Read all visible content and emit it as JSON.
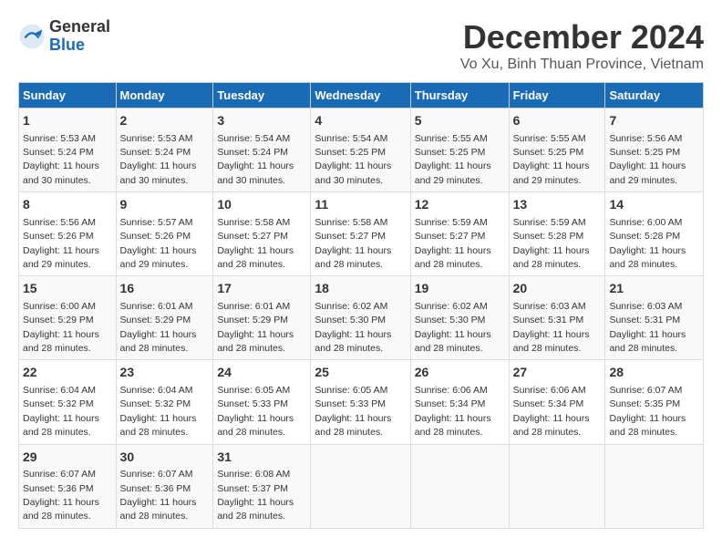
{
  "logo": {
    "general": "General",
    "blue": "Blue"
  },
  "title": "December 2024",
  "subtitle": "Vo Xu, Binh Thuan Province, Vietnam",
  "weekdays": [
    "Sunday",
    "Monday",
    "Tuesday",
    "Wednesday",
    "Thursday",
    "Friday",
    "Saturday"
  ],
  "weeks": [
    [
      {
        "day": "1",
        "sunrise": "5:53 AM",
        "sunset": "5:24 PM",
        "daylight": "11 hours and 30 minutes."
      },
      {
        "day": "2",
        "sunrise": "5:53 AM",
        "sunset": "5:24 PM",
        "daylight": "11 hours and 30 minutes."
      },
      {
        "day": "3",
        "sunrise": "5:54 AM",
        "sunset": "5:24 PM",
        "daylight": "11 hours and 30 minutes."
      },
      {
        "day": "4",
        "sunrise": "5:54 AM",
        "sunset": "5:25 PM",
        "daylight": "11 hours and 30 minutes."
      },
      {
        "day": "5",
        "sunrise": "5:55 AM",
        "sunset": "5:25 PM",
        "daylight": "11 hours and 29 minutes."
      },
      {
        "day": "6",
        "sunrise": "5:55 AM",
        "sunset": "5:25 PM",
        "daylight": "11 hours and 29 minutes."
      },
      {
        "day": "7",
        "sunrise": "5:56 AM",
        "sunset": "5:25 PM",
        "daylight": "11 hours and 29 minutes."
      }
    ],
    [
      {
        "day": "8",
        "sunrise": "5:56 AM",
        "sunset": "5:26 PM",
        "daylight": "11 hours and 29 minutes."
      },
      {
        "day": "9",
        "sunrise": "5:57 AM",
        "sunset": "5:26 PM",
        "daylight": "11 hours and 29 minutes."
      },
      {
        "day": "10",
        "sunrise": "5:58 AM",
        "sunset": "5:27 PM",
        "daylight": "11 hours and 28 minutes."
      },
      {
        "day": "11",
        "sunrise": "5:58 AM",
        "sunset": "5:27 PM",
        "daylight": "11 hours and 28 minutes."
      },
      {
        "day": "12",
        "sunrise": "5:59 AM",
        "sunset": "5:27 PM",
        "daylight": "11 hours and 28 minutes."
      },
      {
        "day": "13",
        "sunrise": "5:59 AM",
        "sunset": "5:28 PM",
        "daylight": "11 hours and 28 minutes."
      },
      {
        "day": "14",
        "sunrise": "6:00 AM",
        "sunset": "5:28 PM",
        "daylight": "11 hours and 28 minutes."
      }
    ],
    [
      {
        "day": "15",
        "sunrise": "6:00 AM",
        "sunset": "5:29 PM",
        "daylight": "11 hours and 28 minutes."
      },
      {
        "day": "16",
        "sunrise": "6:01 AM",
        "sunset": "5:29 PM",
        "daylight": "11 hours and 28 minutes."
      },
      {
        "day": "17",
        "sunrise": "6:01 AM",
        "sunset": "5:29 PM",
        "daylight": "11 hours and 28 minutes."
      },
      {
        "day": "18",
        "sunrise": "6:02 AM",
        "sunset": "5:30 PM",
        "daylight": "11 hours and 28 minutes."
      },
      {
        "day": "19",
        "sunrise": "6:02 AM",
        "sunset": "5:30 PM",
        "daylight": "11 hours and 28 minutes."
      },
      {
        "day": "20",
        "sunrise": "6:03 AM",
        "sunset": "5:31 PM",
        "daylight": "11 hours and 28 minutes."
      },
      {
        "day": "21",
        "sunrise": "6:03 AM",
        "sunset": "5:31 PM",
        "daylight": "11 hours and 28 minutes."
      }
    ],
    [
      {
        "day": "22",
        "sunrise": "6:04 AM",
        "sunset": "5:32 PM",
        "daylight": "11 hours and 28 minutes."
      },
      {
        "day": "23",
        "sunrise": "6:04 AM",
        "sunset": "5:32 PM",
        "daylight": "11 hours and 28 minutes."
      },
      {
        "day": "24",
        "sunrise": "6:05 AM",
        "sunset": "5:33 PM",
        "daylight": "11 hours and 28 minutes."
      },
      {
        "day": "25",
        "sunrise": "6:05 AM",
        "sunset": "5:33 PM",
        "daylight": "11 hours and 28 minutes."
      },
      {
        "day": "26",
        "sunrise": "6:06 AM",
        "sunset": "5:34 PM",
        "daylight": "11 hours and 28 minutes."
      },
      {
        "day": "27",
        "sunrise": "6:06 AM",
        "sunset": "5:34 PM",
        "daylight": "11 hours and 28 minutes."
      },
      {
        "day": "28",
        "sunrise": "6:07 AM",
        "sunset": "5:35 PM",
        "daylight": "11 hours and 28 minutes."
      }
    ],
    [
      {
        "day": "29",
        "sunrise": "6:07 AM",
        "sunset": "5:36 PM",
        "daylight": "11 hours and 28 minutes."
      },
      {
        "day": "30",
        "sunrise": "6:07 AM",
        "sunset": "5:36 PM",
        "daylight": "11 hours and 28 minutes."
      },
      {
        "day": "31",
        "sunrise": "6:08 AM",
        "sunset": "5:37 PM",
        "daylight": "11 hours and 28 minutes."
      },
      null,
      null,
      null,
      null
    ]
  ]
}
